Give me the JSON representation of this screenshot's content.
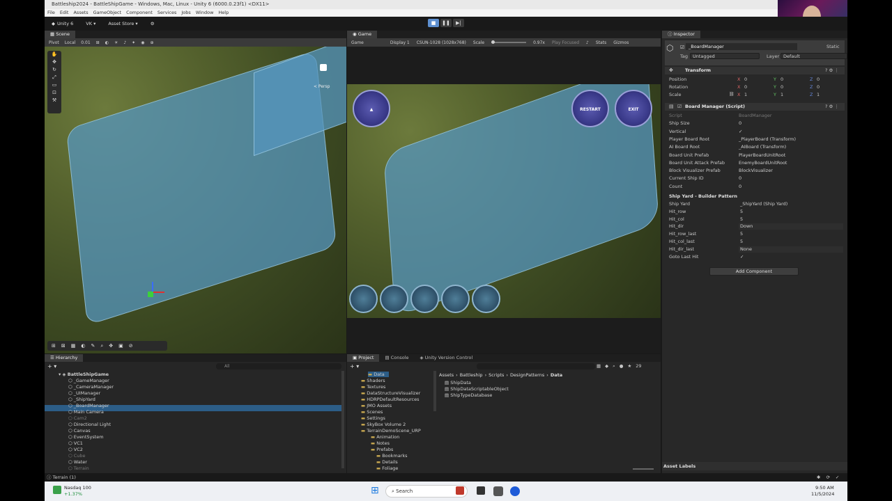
{
  "window": {
    "title": "Battleship2024 - BattleShipGame - Windows, Mac, Linux - Unity 6 (6000.0.23f1) <DX11>",
    "menu": [
      "File",
      "Edit",
      "Assets",
      "GameObject",
      "Component",
      "Services",
      "Jobs",
      "Window",
      "Help"
    ]
  },
  "toolbar": {
    "unity_label": "Unity 6",
    "account": "VK",
    "asset_store": "Asset Store"
  },
  "scene": {
    "tab": "Scene",
    "pivot": "Pivot",
    "local": "Local",
    "snap": "0.01",
    "persp": "< Persp"
  },
  "game": {
    "tab": "Game",
    "mode": "Game",
    "display": "Display 1",
    "resolution": "CSUN-1028 (1028x768)",
    "scale_label": "Scale",
    "scale_value": "0.97x",
    "play_focused": "Play Focused",
    "stats": "Stats",
    "gizmos": "Gizmos",
    "btn_restart": "RESTART",
    "btn_exit": "EXIT"
  },
  "inspector": {
    "tab": "Inspector",
    "object_name": "_BoardManager",
    "static_label": "Static",
    "tag_label": "Tag",
    "tag_value": "Untagged",
    "layer_label": "Layer",
    "layer_value": "Default",
    "transform": {
      "title": "Transform",
      "position": "Position",
      "rotation": "Rotation",
      "scale": "Scale",
      "pos": [
        "0",
        "0",
        "0"
      ],
      "rot": [
        "0",
        "0",
        "0"
      ],
      "scl": [
        "1",
        "1",
        "1"
      ]
    },
    "script": {
      "title": "Board Manager (Script)",
      "rows": [
        {
          "label": "Script",
          "value": "BoardManager"
        },
        {
          "label": "Ship Size",
          "value": "0"
        },
        {
          "label": "Vertical",
          "value": "✓"
        },
        {
          "label": "Player Board Root",
          "value": "_PlayerBoard (Transform)"
        },
        {
          "label": "AI Board Root",
          "value": "_AIBoard (Transform)"
        },
        {
          "label": "Board Unit Prefab",
          "value": "PlayerBoardUnitRoot"
        },
        {
          "label": "Board Unit Attack Prefab",
          "value": "EnemyBoardUnitRoot"
        },
        {
          "label": "Block Visualizer Prefab",
          "value": "BlockVisualizer"
        },
        {
          "label": "Current Ship ID",
          "value": "0"
        },
        {
          "label": "Count",
          "value": "0"
        }
      ],
      "section2": "Ship Yard - Builder Pattern",
      "rows2": [
        {
          "label": "Ship Yard",
          "value": "_ShipYard (Ship Yard)"
        },
        {
          "label": "Hit_row",
          "value": "5"
        },
        {
          "label": "Hit_col",
          "value": "5"
        },
        {
          "label": "Hit_dir",
          "value": "Down"
        },
        {
          "label": "Hit_row_last",
          "value": "5"
        },
        {
          "label": "Hit_col_last",
          "value": "5"
        },
        {
          "label": "Hit_dir_last",
          "value": "None"
        },
        {
          "label": "Goto Last Hit",
          "value": "✓"
        }
      ],
      "add_component": "Add Component",
      "asset_labels": "Asset Labels"
    }
  },
  "hierarchy": {
    "tab": "Hierarchy",
    "search_placeholder": "All",
    "root": "BattleShipGame",
    "items": [
      "_GameManager",
      "_CameraManager",
      "_UIManager",
      "_ShipYard",
      "_BoardManager",
      "Main Camera",
      "Cam2",
      "Directional Light",
      "Canvas",
      "EventSystem",
      "VC1",
      "VC2",
      "Cube",
      "Water",
      "Terrain"
    ]
  },
  "project": {
    "tabs": [
      "Project",
      "Console",
      "Unity Version Control"
    ],
    "breadcrumb": [
      "Assets",
      "Battleship",
      "Scripts",
      "DesignPatterns",
      "Data"
    ],
    "tree": [
      "Data",
      "Shaders",
      "Textures",
      "DataStructureVisualizer",
      "HDRPDefaultResources",
      "JMO Assets",
      "Scenes",
      "Settings",
      "SkyBox Volume 2",
      "TerrainDemoScene_URP",
      "Animation",
      "Notes",
      "Prefabs",
      "Bookmarks",
      "Details",
      "Foliage"
    ],
    "files": [
      "ShipData",
      "ShipDataScriptableObject",
      "ShipTypeDatabase"
    ],
    "count": "29"
  },
  "status": {
    "text": "Terrain (1)"
  },
  "taskbar": {
    "stock_name": "Nasdaq 100",
    "stock_change": "+1.37%",
    "search": "Search",
    "time": "9:50 AM",
    "date": "11/5/2024"
  }
}
